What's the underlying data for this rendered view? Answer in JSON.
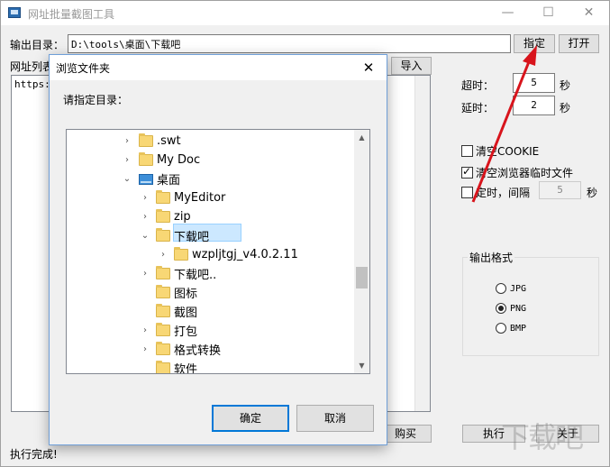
{
  "window": {
    "title": "网址批量截图工具",
    "min_glyph": "—",
    "max_glyph": "☐",
    "close_glyph": "✕"
  },
  "output": {
    "label": "输出目录：",
    "value": "D:\\tools\\桌面\\下载吧",
    "browse_label": "指定",
    "open_label": "打开"
  },
  "urls": {
    "label": "网址列表",
    "import_label": "导入",
    "first_line": "https:/"
  },
  "settings": {
    "timeout_label": "超时：",
    "timeout_value": "5",
    "timeout_unit": "秒",
    "delay_label": "延时：",
    "delay_value": "2",
    "delay_unit": "秒",
    "clear_cookie_label": "清空COOKIE",
    "clear_temp_label": "清空浏览器临时文件",
    "timer_label": "定时，间隔",
    "timer_value": "5",
    "timer_unit": "秒"
  },
  "format": {
    "group_label": "输出格式",
    "options": [
      "JPG",
      "PNG",
      "BMP"
    ],
    "selected": "PNG"
  },
  "bottom": {
    "buy_label": "购买",
    "run_label": "执行",
    "about_label": "关于",
    "status": "执行完成!"
  },
  "dialog": {
    "title": "浏览文件夹",
    "close_glyph": "✕",
    "prompt": "请指定目录：",
    "ok_label": "确定",
    "cancel_label": "取消",
    "tree": [
      {
        "label": ".swt",
        "expand": ">"
      },
      {
        "label": "My Doc",
        "expand": ">"
      },
      {
        "label": "桌面",
        "expand": "v"
      },
      {
        "label": "MyEditor",
        "expand": ">"
      },
      {
        "label": "zip",
        "expand": ">"
      },
      {
        "label": "下载吧",
        "expand": "v"
      },
      {
        "label": "wzpljtgj_v4.0.2.11",
        "expand": ">"
      },
      {
        "label": "下载吧..",
        "expand": ">"
      },
      {
        "label": "图标",
        "expand": ""
      },
      {
        "label": "截图",
        "expand": ""
      },
      {
        "label": "打包",
        "expand": ">"
      },
      {
        "label": "格式转换",
        "expand": ">"
      },
      {
        "label": "软件",
        "expand": ""
      }
    ]
  },
  "watermark": "下载吧"
}
